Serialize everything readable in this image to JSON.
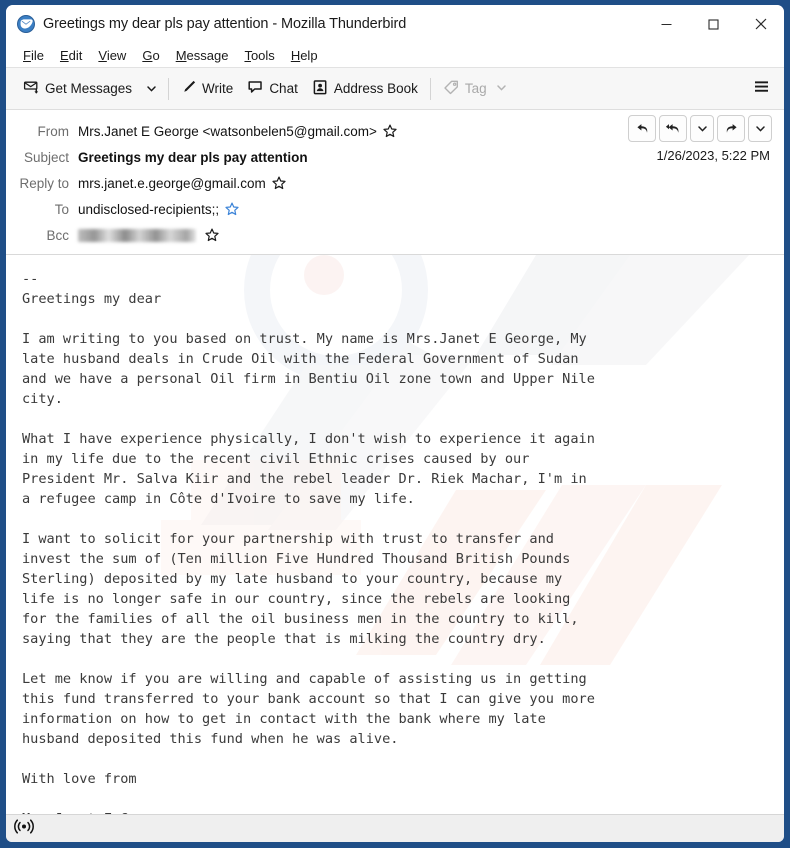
{
  "window": {
    "title": "Greetings my dear pls pay attention - Mozilla Thunderbird",
    "logo_icon": "thunderbird-logo",
    "minimize_icon": "minimize-icon",
    "maximize_icon": "maximize-icon",
    "close_icon": "close-icon",
    "frame_color": "#1f4e87"
  },
  "menubar": {
    "items": [
      {
        "label": "File",
        "accesskey": "F"
      },
      {
        "label": "Edit",
        "accesskey": "E"
      },
      {
        "label": "View",
        "accesskey": "V"
      },
      {
        "label": "Go",
        "accesskey": "G"
      },
      {
        "label": "Message",
        "accesskey": "M"
      },
      {
        "label": "Tools",
        "accesskey": "T"
      },
      {
        "label": "Help",
        "accesskey": "H"
      }
    ]
  },
  "toolbar": {
    "get_messages_label": "Get Messages",
    "get_messages_icon": "get-messages-icon",
    "get_messages_caret_icon": "chevron-down-icon",
    "write_label": "Write",
    "write_icon": "pencil-icon",
    "chat_label": "Chat",
    "chat_icon": "chat-bubble-icon",
    "address_book_label": "Address Book",
    "address_book_icon": "address-book-icon",
    "tag_label": "Tag",
    "tag_icon": "tag-icon",
    "tag_caret_icon": "chevron-down-icon",
    "tag_disabled": true,
    "hamburger_icon": "hamburger-menu-icon"
  },
  "message_header": {
    "from_label": "From",
    "from_value": "Mrs.Janet E George <watsonbelen5@gmail.com>",
    "subject_label": "Subject",
    "subject_value": "Greetings my dear pls pay attention",
    "reply_to_label": "Reply to",
    "reply_to_value": "mrs.janet.e.george@gmail.com",
    "to_label": "To",
    "to_value": "undisclosed-recipients;;",
    "bcc_label": "Bcc",
    "bcc_value": "",
    "bcc_redacted": true,
    "datetime": "1/26/2023, 5:22 PM",
    "star_icon": "star-icon",
    "actions": [
      {
        "name": "reply-button",
        "icon": "reply-icon"
      },
      {
        "name": "reply-all-button",
        "icon": "reply-all-icon"
      },
      {
        "name": "reply-more-button",
        "icon": "chevron-down-icon"
      },
      {
        "name": "forward-button",
        "icon": "forward-arrow-icon"
      },
      {
        "name": "more-actions-button",
        "icon": "chevron-down-icon"
      }
    ]
  },
  "message_body": {
    "text": "--\nGreetings my dear\n\nI am writing to you based on trust. My name is Mrs.Janet E George, My\nlate husband deals in Crude Oil with the Federal Government of Sudan\nand we have a personal Oil firm in Bentiu Oil zone town and Upper Nile\ncity.\n\nWhat I have experience physically, I don't wish to experience it again\nin my life due to the recent civil Ethnic crises caused by our\nPresident Mr. Salva Kiir and the rebel leader Dr. Riek Machar, I'm in\na refugee camp in Côte d'Ivoire to save my life.\n\nI want to solicit for your partnership with trust to transfer and\ninvest the sum of (Ten million Five Hundred Thousand British Pounds\nSterling) deposited by my late husband to your country, because my\nlife is no longer safe in our country, since the rebels are looking\nfor the families of all the oil business men in the country to kill,\nsaying that they are the people that is milking the country dry.\n\nLet me know if you are willing and capable of assisting us in getting\nthis fund transferred to your bank account so that I can give you more\ninformation on how to get in contact with the bank where my late\nhusband deposited this fund when he was alive.\n\nWith love from\n\nMrs.Janet E George"
  },
  "status_bar": {
    "icon": "broadcast-signal-icon",
    "text": ""
  }
}
